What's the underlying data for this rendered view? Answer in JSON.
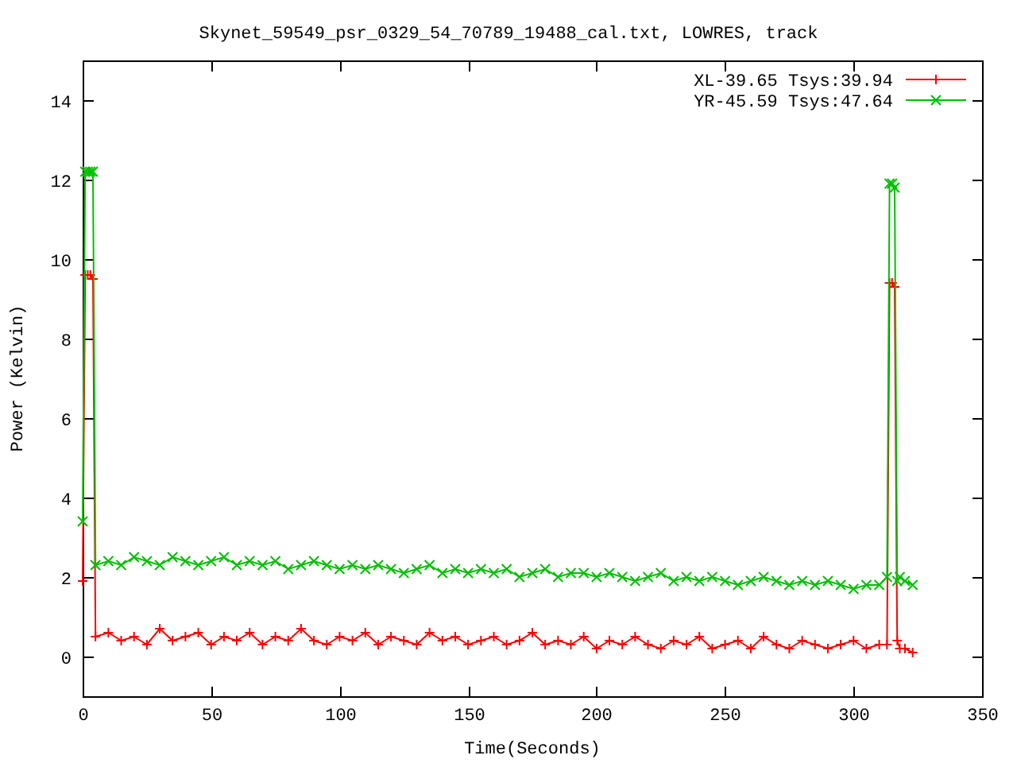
{
  "chart_data": {
    "type": "line",
    "title": "Skynet_59549_psr_0329_54_70789_19488_cal.txt, LOWRES, track",
    "xlabel": "Time(Seconds)",
    "ylabel": "Power (Kelvin)",
    "x": [
      0,
      1,
      2,
      3,
      4,
      5,
      10,
      15,
      20,
      25,
      30,
      35,
      40,
      45,
      50,
      55,
      60,
      65,
      70,
      75,
      80,
      85,
      90,
      95,
      100,
      105,
      110,
      115,
      120,
      125,
      130,
      135,
      140,
      145,
      150,
      155,
      160,
      165,
      170,
      175,
      180,
      185,
      190,
      195,
      200,
      205,
      210,
      215,
      220,
      225,
      230,
      235,
      240,
      245,
      250,
      255,
      260,
      265,
      270,
      275,
      280,
      285,
      290,
      295,
      300,
      305,
      310,
      313,
      314,
      315,
      316,
      317,
      318,
      320,
      323
    ],
    "series": [
      {
        "name": "XL-39.65 Tsys:39.94",
        "color": "#ff0000",
        "marker": "plus",
        "values": [
          1.9,
          9.6,
          9.6,
          9.6,
          9.5,
          0.5,
          0.6,
          0.4,
          0.5,
          0.3,
          0.7,
          0.4,
          0.5,
          0.6,
          0.3,
          0.5,
          0.4,
          0.6,
          0.3,
          0.5,
          0.4,
          0.7,
          0.4,
          0.3,
          0.5,
          0.4,
          0.6,
          0.3,
          0.5,
          0.4,
          0.3,
          0.6,
          0.4,
          0.5,
          0.3,
          0.4,
          0.5,
          0.3,
          0.4,
          0.6,
          0.3,
          0.4,
          0.3,
          0.5,
          0.2,
          0.4,
          0.3,
          0.5,
          0.3,
          0.2,
          0.4,
          0.3,
          0.5,
          0.2,
          0.3,
          0.4,
          0.2,
          0.5,
          0.3,
          0.2,
          0.4,
          0.3,
          0.2,
          0.3,
          0.4,
          0.2,
          0.3,
          0.3,
          9.4,
          9.4,
          9.3,
          0.4,
          0.2,
          0.2,
          0.1
        ]
      },
      {
        "name": "YR-45.59 Tsys:47.64",
        "color": "#00c000",
        "marker": "cross",
        "values": [
          3.4,
          12.2,
          12.2,
          12.2,
          12.2,
          2.3,
          2.4,
          2.3,
          2.5,
          2.4,
          2.3,
          2.5,
          2.4,
          2.3,
          2.4,
          2.5,
          2.3,
          2.4,
          2.3,
          2.4,
          2.2,
          2.3,
          2.4,
          2.3,
          2.2,
          2.3,
          2.2,
          2.3,
          2.2,
          2.1,
          2.2,
          2.3,
          2.1,
          2.2,
          2.1,
          2.2,
          2.1,
          2.2,
          2.0,
          2.1,
          2.2,
          2.0,
          2.1,
          2.1,
          2.0,
          2.1,
          2.0,
          1.9,
          2.0,
          2.1,
          1.9,
          2.0,
          1.9,
          2.0,
          1.9,
          1.8,
          1.9,
          2.0,
          1.9,
          1.8,
          1.9,
          1.8,
          1.9,
          1.8,
          1.7,
          1.8,
          1.8,
          2.0,
          11.9,
          11.9,
          11.8,
          1.9,
          2.0,
          1.9,
          1.8
        ]
      }
    ],
    "legend": true,
    "xlim": [
      0,
      350
    ],
    "ylim": [
      -1,
      15
    ],
    "xticks": [
      0,
      50,
      100,
      150,
      200,
      250,
      300,
      350
    ],
    "yticks": [
      0,
      2,
      4,
      6,
      8,
      10,
      12,
      14
    ]
  }
}
